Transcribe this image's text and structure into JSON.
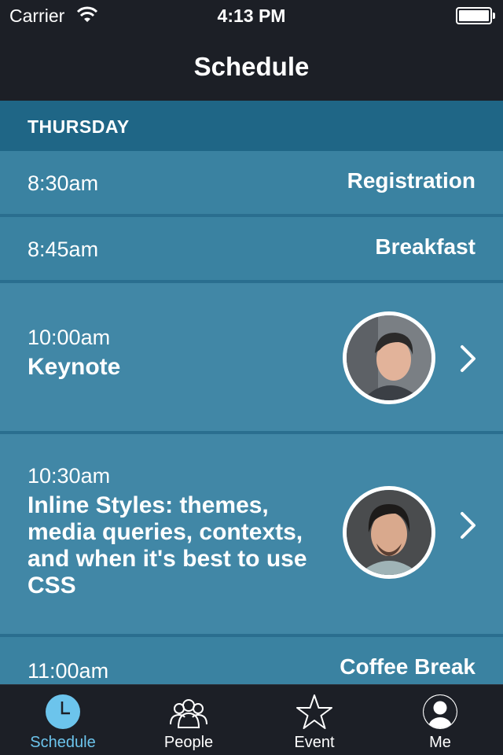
{
  "status_bar": {
    "carrier": "Carrier",
    "time": "4:13 PM"
  },
  "nav": {
    "title": "Schedule"
  },
  "section": {
    "day": "THURSDAY"
  },
  "rows": [
    {
      "time": "8:30am",
      "title": "Registration"
    },
    {
      "time": "8:45am",
      "title": "Breakfast"
    },
    {
      "time": "10:00am",
      "title": "Keynote"
    },
    {
      "time": "10:30am",
      "title": "Inline Styles: themes, media queries, contexts, and when it's best to use CSS"
    },
    {
      "time": "11:00am",
      "title": "Coffee Break"
    }
  ],
  "tabs": [
    {
      "label": "Schedule",
      "icon": "clock-icon",
      "active": true
    },
    {
      "label": "People",
      "icon": "people-icon",
      "active": false
    },
    {
      "label": "Event",
      "icon": "star-icon",
      "active": false
    },
    {
      "label": "Me",
      "icon": "person-icon",
      "active": false
    }
  ],
  "colors": {
    "bar_background": "#1c1f26",
    "section_header": "#1f6686",
    "row_background": "#3a82a1",
    "active_tab": "#6cc4ec"
  }
}
